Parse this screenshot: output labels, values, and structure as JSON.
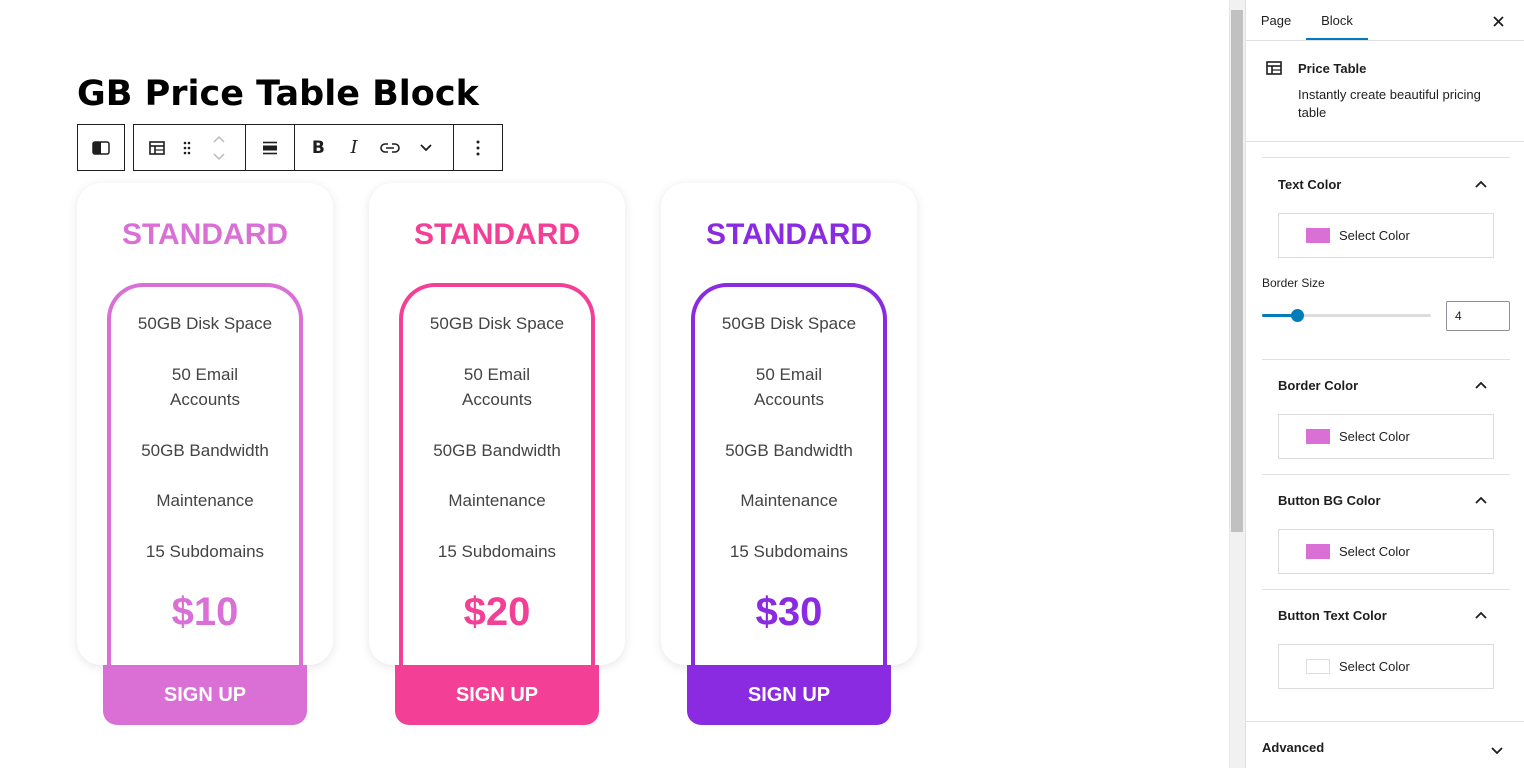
{
  "page": {
    "title": "GB Price Table Block"
  },
  "cards": [
    {
      "title": "STANDARD",
      "features": [
        "50GB Disk Space",
        "50 Email Accounts",
        "50GB Bandwidth",
        "Maintenance",
        "15 Subdomains"
      ],
      "price": "$10",
      "button": "SIGN UP",
      "color": "#da70d6"
    },
    {
      "title": "STANDARD",
      "features": [
        "50GB Disk Space",
        "50 Email Accounts",
        "50GB Bandwidth",
        "Maintenance",
        "15 Subdomains"
      ],
      "price": "$20",
      "button": "SIGN UP",
      "color": "#f43f97"
    },
    {
      "title": "STANDARD",
      "features": [
        "50GB Disk Space",
        "50 Email Accounts",
        "50GB Bandwidth",
        "Maintenance",
        "15 Subdomains"
      ],
      "price": "$30",
      "button": "SIGN UP",
      "color": "#8a2be2"
    }
  ],
  "toolbar": {
    "icons": [
      "block-layout-icon",
      "table-icon",
      "drag-handle-icon",
      "move-up-icon",
      "move-down-icon",
      "align-icon",
      "bold-icon",
      "italic-icon",
      "link-icon",
      "more-rich-text-icon",
      "options-icon"
    ]
  },
  "sidebar": {
    "tabs": [
      "Page",
      "Block"
    ],
    "active_tab": "Block",
    "block": {
      "name": "Price Table",
      "description": "Instantly create beautiful pricing table"
    },
    "text_color": {
      "title": "Text Color",
      "select_label": "Select Color",
      "swatch": "#da70d6"
    },
    "border_size": {
      "label": "Border Size",
      "value": "4",
      "slider_percent": 20
    },
    "border_color": {
      "title": "Border Color",
      "select_label": "Select Color",
      "swatch": "#da70d6"
    },
    "button_bg_color": {
      "title": "Button BG Color",
      "select_label": "Select Color",
      "swatch": "#da70d6"
    },
    "button_text_color": {
      "title": "Button Text Color",
      "select_label": "Select Color",
      "swatch": "#ffffff"
    },
    "advanced": {
      "title": "Advanced"
    }
  }
}
